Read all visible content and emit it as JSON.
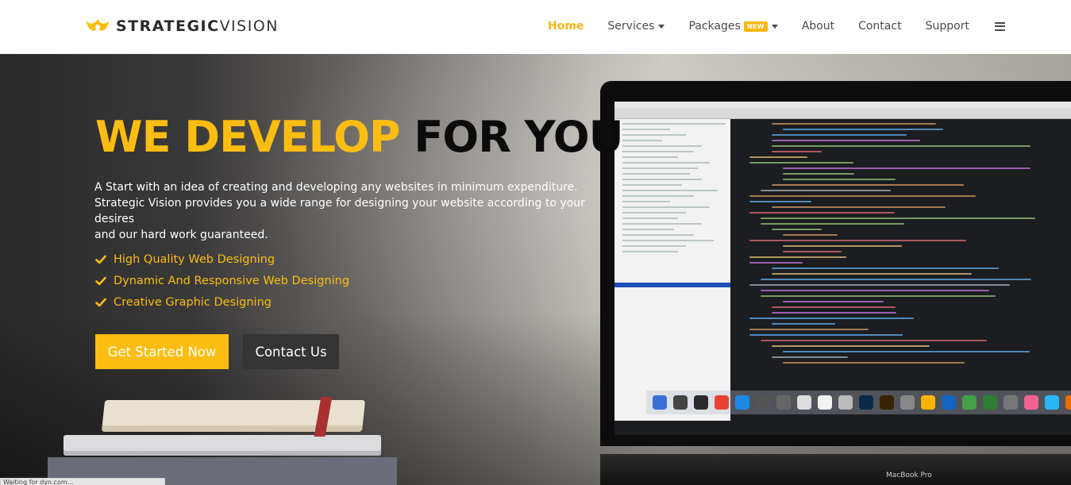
{
  "brand": {
    "name_bold": "STRATEGIC",
    "name_light": "VISION",
    "accent": "#fbbd12"
  },
  "nav": {
    "items": [
      {
        "label": "Home",
        "active": true
      },
      {
        "label": "Services",
        "dropdown": true
      },
      {
        "label": "Packages",
        "badge": "NEW",
        "dropdown": true
      },
      {
        "label": "About"
      },
      {
        "label": "Contact"
      },
      {
        "label": "Support"
      }
    ],
    "menu_icon": "hamburger-icon"
  },
  "hero": {
    "headline_accent": "WE DEVELOP",
    "headline_rest": "FOR YOU",
    "intro_lines": [
      "A Start with an idea of creating and developing any websites in minimum expenditure.",
      "Strategic Vision provides you a wide range for designing your website according to your desires",
      "and our hard work guaranteed."
    ],
    "features": [
      "High Quality Web Designing",
      "Dynamic And Responsive Web Designing",
      "Creative Graphic Designing"
    ],
    "feature_icon": "check-icon",
    "primary_button": "Get Started Now",
    "secondary_button": "Contact Us",
    "laptop_label": "MacBook Pro"
  },
  "status": {
    "text": "Waiting for dyn.com..."
  },
  "colors": {
    "accent": "#fbbd12",
    "dark_button": "#343434",
    "nav_text": "#4a4a4a"
  }
}
